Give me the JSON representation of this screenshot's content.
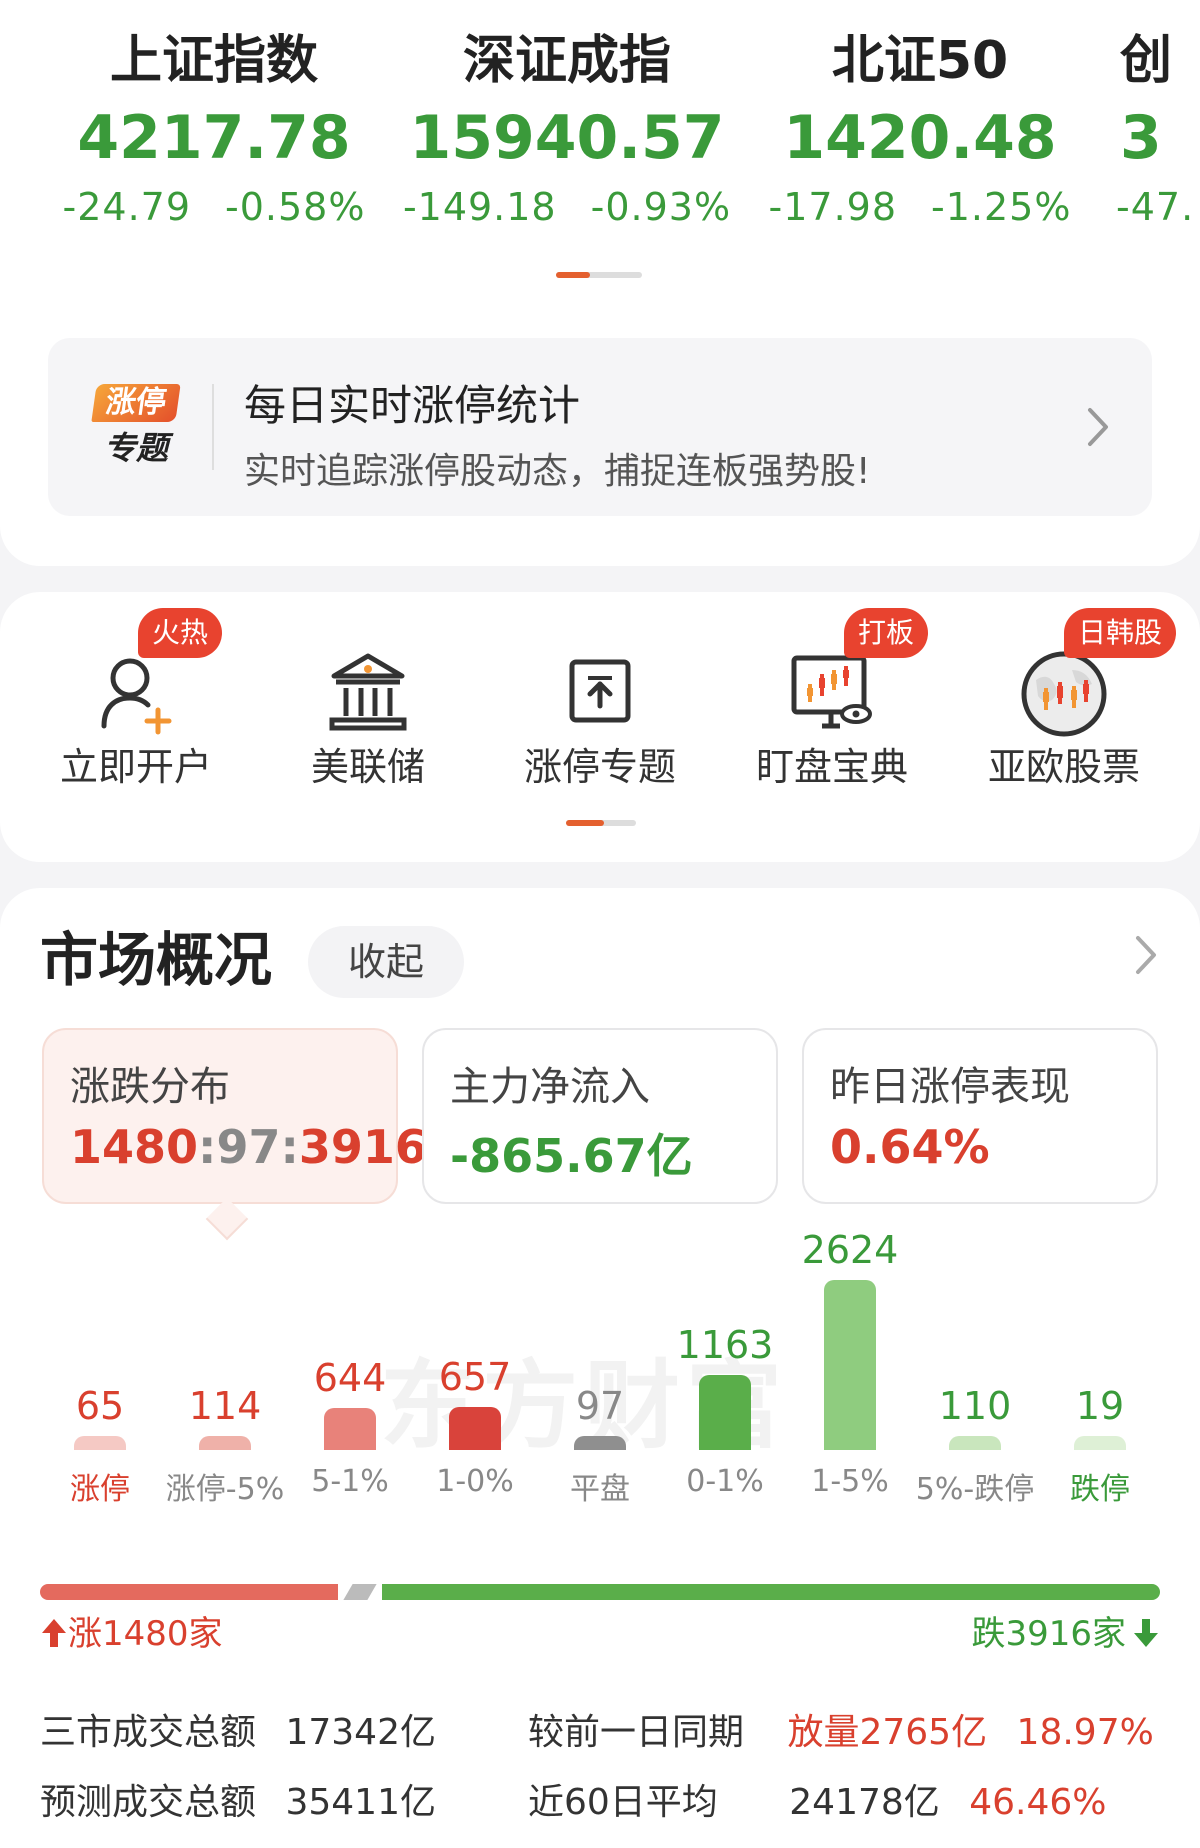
{
  "indices": [
    {
      "name": "上证指数",
      "value": "4217.78",
      "change": "-24.79",
      "pct": "-0.58%"
    },
    {
      "name": "深证成指",
      "value": "15940.57",
      "change": "-149.18",
      "pct": "-0.93%"
    },
    {
      "name": "北证50",
      "value": "1420.48",
      "change": "-17.98",
      "pct": "-1.25%"
    },
    {
      "name": "创",
      "value": "3",
      "change": "-47.",
      "pct": ""
    }
  ],
  "banner": {
    "logo_top": "涨停",
    "logo_bottom": "专题",
    "title": "每日实时涨停统计",
    "subtitle": "实时追踪涨停股动态，捕捉连板强势股!"
  },
  "shortcuts": [
    {
      "label": "立即开户",
      "badge": "火热",
      "icon": "user-add-icon"
    },
    {
      "label": "美联储",
      "badge": "",
      "icon": "bank-icon"
    },
    {
      "label": "涨停专题",
      "badge": "",
      "icon": "limit-up-icon"
    },
    {
      "label": "盯盘宝典",
      "badge": "打板",
      "icon": "monitor-chart-icon"
    },
    {
      "label": "亚欧股票",
      "badge": "日韩股",
      "icon": "globe-chart-icon"
    }
  ],
  "market": {
    "title": "市场概况",
    "collapse_label": "收起",
    "stats": [
      {
        "label": "涨跌分布",
        "value_up": "1480",
        "value_flat": "97",
        "value_down": "3916"
      },
      {
        "label": "主力净流入",
        "value": "-865.67亿"
      },
      {
        "label": "昨日涨停表现",
        "value": "0.64%"
      }
    ],
    "watermark": "东方财富",
    "rise_label": "涨1480家",
    "fall_label": "跌3916家",
    "summary": {
      "total_label": "三市成交总额",
      "total_value": "17342亿",
      "compare_label": "较前一日同期",
      "compare_value": "放量2765亿",
      "compare_pct": "18.97%",
      "forecast_label": "预测成交总额",
      "forecast_value": "35411亿",
      "avg_label": "近60日平均",
      "avg_value": "24178亿",
      "avg_pct": "46.46%"
    }
  },
  "chart_data": {
    "type": "bar",
    "categories": [
      "涨停",
      "涨停-5%",
      "5-1%",
      "1-0%",
      "平盘",
      "0-1%",
      "1-5%",
      "5%-跌停",
      "跌停"
    ],
    "values": [
      65,
      114,
      644,
      657,
      97,
      1163,
      2624,
      110,
      19
    ],
    "value_labels": [
      "65",
      "114",
      "644",
      "657",
      "97",
      "1163",
      "2624",
      "110",
      "19"
    ],
    "colors": [
      "#f5c9c4",
      "#efb1a9",
      "#e8827a",
      "#d9433b",
      "#8f8f8f",
      "#5aae4a",
      "#8fcc7f",
      "#c9e6bd",
      "#def0d6"
    ],
    "label_colors": [
      "#d9402e",
      "#d9402e",
      "#d9402e",
      "#d9402e",
      "#888888",
      "#3a9a3a",
      "#3a9a3a",
      "#3a9a3a",
      "#3a9a3a"
    ],
    "category_colors": [
      "#d9402e",
      "#888888",
      "#888888",
      "#888888",
      "#888888",
      "#888888",
      "#888888",
      "#888888",
      "#3a9a3a"
    ]
  }
}
